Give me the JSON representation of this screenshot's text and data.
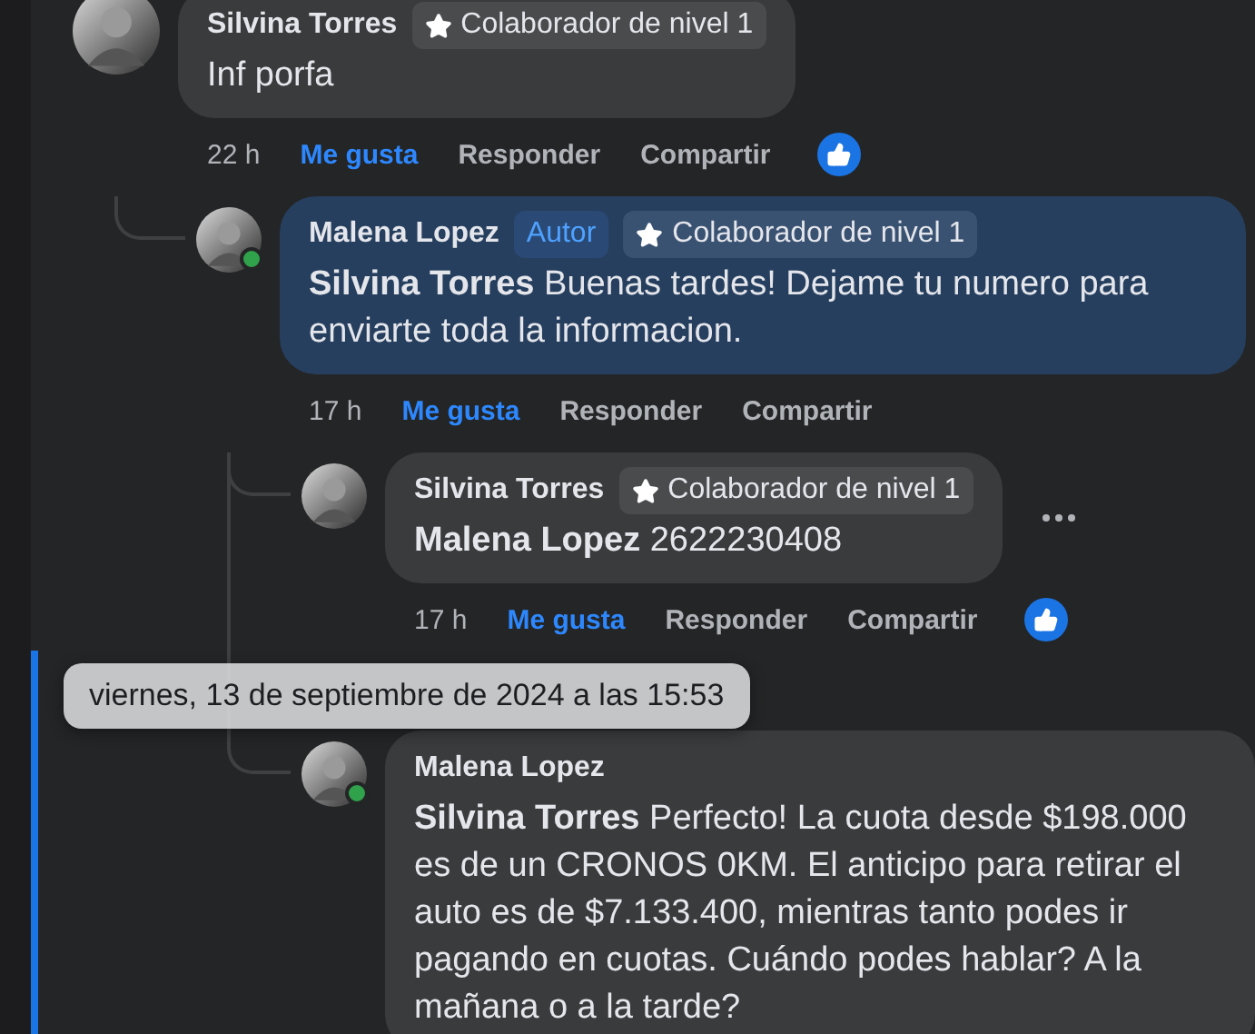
{
  "comments": [
    {
      "author": "Silvina Torres",
      "is_author": false,
      "badges": [
        {
          "kind": "level",
          "label": "Colaborador de nivel 1"
        }
      ],
      "text": "Inf porfa",
      "time": "22 h",
      "actions": [
        {
          "label": "Me gusta",
          "selected": true
        },
        {
          "label": "Responder",
          "selected": false
        },
        {
          "label": "Compartir",
          "selected": false
        }
      ],
      "has_reaction": true,
      "children": [
        {
          "author": "Malena Lopez",
          "online": true,
          "is_author": true,
          "badges": [
            {
              "kind": "author",
              "label": "Autor"
            },
            {
              "kind": "level",
              "label": "Colaborador de nivel 1"
            }
          ],
          "text": "**Silvina Torres** Buenas tardes! Dejame tu numero para enviarte toda la informacion.",
          "time": "17 h",
          "actions": [
            {
              "label": "Me gusta",
              "selected": true
            },
            {
              "label": "Responder",
              "selected": false
            },
            {
              "label": "Compartir",
              "selected": false
            }
          ],
          "children": [
            {
              "author": "Silvina Torres",
              "is_author": false,
              "badges": [
                {
                  "kind": "level",
                  "label": "Colaborador de nivel 1"
                }
              ],
              "text": "**Malena Lopez** 2622230408",
              "time": "17 h",
              "actions": [
                {
                  "label": "Me gusta",
                  "selected": true
                },
                {
                  "label": "Responder",
                  "selected": false
                },
                {
                  "label": "Compartir",
                  "selected": false
                }
              ],
              "has_reaction": true,
              "more_button": true
            },
            {
              "author": "Malena Lopez",
              "online": true,
              "is_author": false,
              "selected": true,
              "tooltip": "viernes, 13 de septiembre de 2024 a las 15:53",
              "text": "**Silvina Torres** Perfecto! La cuota desde $198.000 es de un CRONOS 0KM. El anticipo para retirar el auto es de $7.133.400, mientras tanto podes ir pagando en cuotas. Cuándo podes hablar? A la mañana o a la tarde?"
            }
          ]
        }
      ]
    }
  ]
}
